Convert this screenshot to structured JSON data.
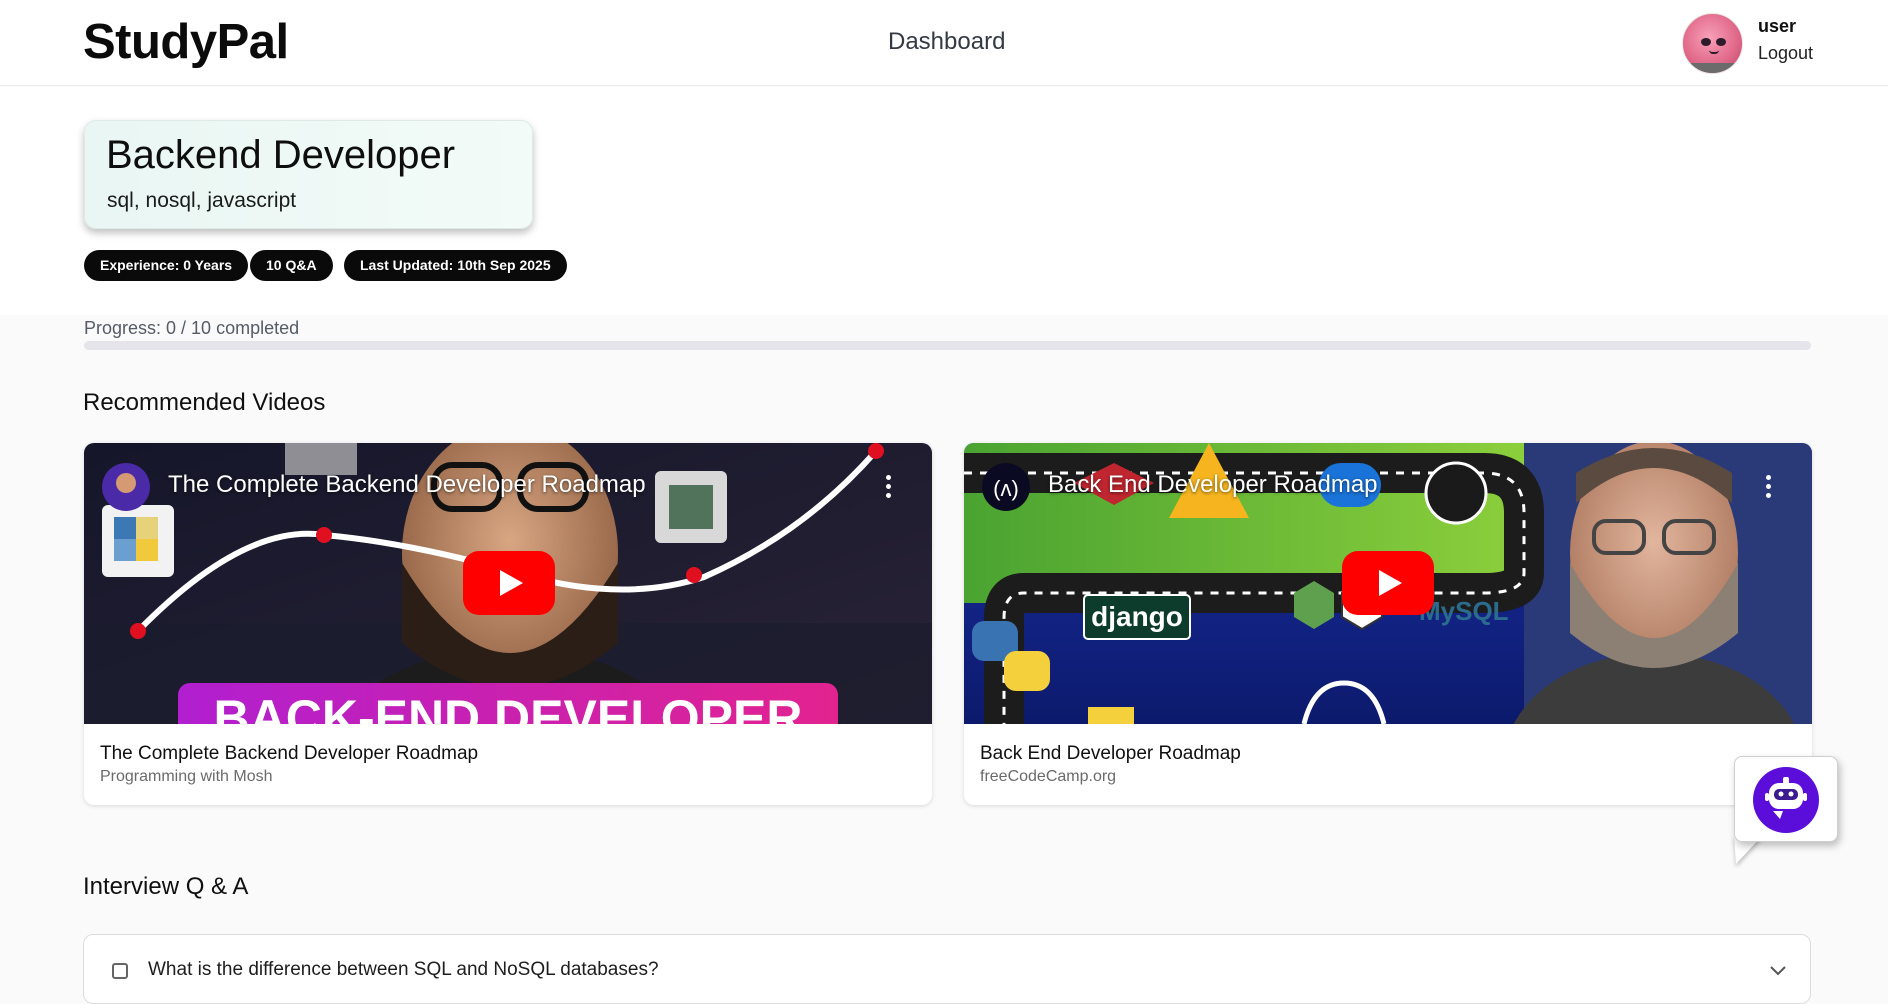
{
  "app": {
    "name": "StudyPal"
  },
  "nav": {
    "dashboard": "Dashboard"
  },
  "user": {
    "name": "user",
    "logout": "Logout"
  },
  "role": {
    "title": "Backend Developer",
    "skills": "sql, nosql, javascript"
  },
  "badges": {
    "experience": "Experience: 0 Years",
    "qa_count": "10 Q&A",
    "updated": "Last Updated: 10th Sep 2025"
  },
  "progress": {
    "label": "Progress: 0 / 10 completed",
    "completed": 0,
    "total": 10
  },
  "sections": {
    "videos": "Recommended Videos",
    "qa": "Interview Q & A"
  },
  "videos": [
    {
      "overlay_title": "The Complete Backend Developer Roadmap",
      "title": "The Complete Backend Developer Roadmap",
      "channel": "Programming with Mosh",
      "banner_text": "BACK-END DEVELOPER"
    },
    {
      "overlay_title": "Back End Developer Roadmap",
      "title": "Back End Developer Roadmap",
      "channel": "freeCodeCamp.org",
      "logo_text": "django",
      "logo_text_2": "MySQL"
    }
  ],
  "qa": [
    {
      "question": "What is the difference between SQL and NoSQL databases?",
      "checked": false
    }
  ],
  "colors": {
    "accent": "#5b21b6",
    "bot": "#5b0dd9",
    "badge_bg": "#0a0a0a",
    "youtube_red": "#ff0000"
  },
  "icons": [
    "avatar",
    "youtube-play-icon",
    "more-vert-icon",
    "chatbot-icon",
    "chevron-down-icon",
    "checkbox"
  ]
}
